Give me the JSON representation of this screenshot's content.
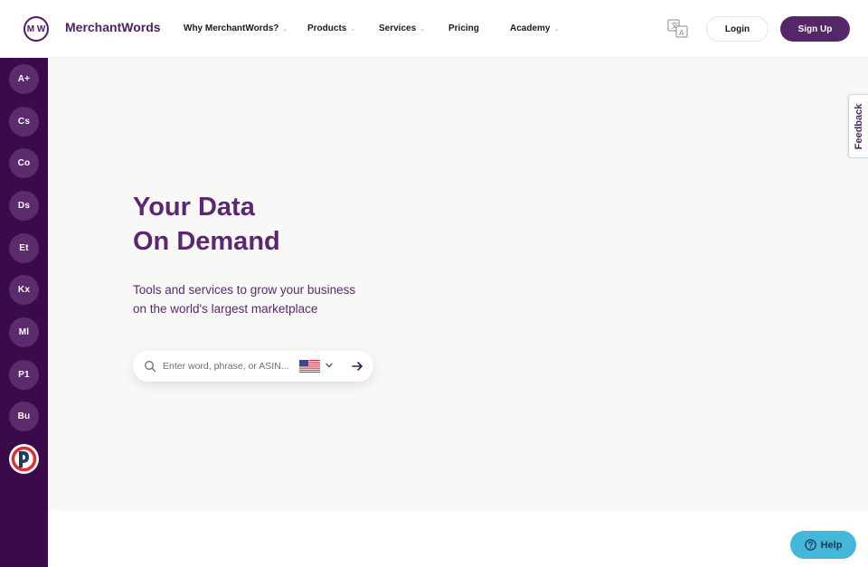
{
  "header": {
    "logo_mark": "M W",
    "logo_text": "MerchantWords",
    "nav": [
      {
        "label": "Why MerchantWords?",
        "has_dropdown": true
      },
      {
        "label": "Products",
        "has_dropdown": true
      },
      {
        "label": "Services",
        "has_dropdown": true
      },
      {
        "label": "Pricing",
        "has_dropdown": false
      },
      {
        "label": "Academy",
        "has_dropdown": true
      }
    ],
    "language_icon": "translate-icon",
    "login_label": "Login",
    "signup_label": "Sign Up"
  },
  "rail": {
    "items": [
      "A+",
      "Cs",
      "Co",
      "Ds",
      "Et",
      "Kx",
      "Ml",
      "P1",
      "Bu"
    ],
    "logo_icon": "extension-logo-icon"
  },
  "hero": {
    "title_line1": "Your Data",
    "title_line2": "On Demand",
    "subtitle_line1": "Tools and services to grow your business",
    "subtitle_line2": "on the world's largest marketplace"
  },
  "search": {
    "placeholder": "Enter word, phrase, or ASIN...",
    "value": "",
    "marketplace_flag": "us-flag-icon"
  },
  "feedback_label": "Feedback",
  "help_label": "Help",
  "colors": {
    "brand_purple": "#552769",
    "rail_bg": "#3a0a4a",
    "rail_button": "#5c2b6c",
    "hero_bg": "#f8f8f7",
    "help_bg": "#45b7db"
  }
}
